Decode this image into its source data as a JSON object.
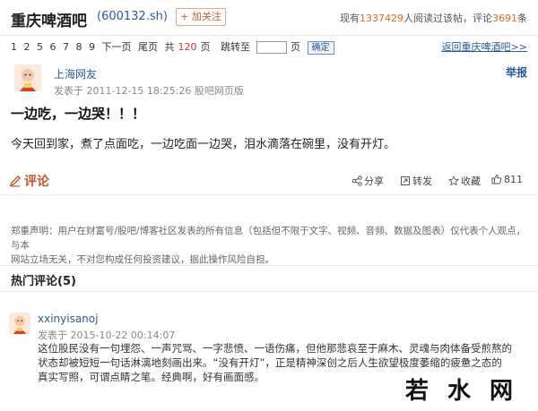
{
  "header": {
    "title": "重庆啤酒吧",
    "stock_code": "(600132.sh)",
    "follow_label": "+ 加关注",
    "stats_prefix": "现有",
    "readers": "1337429",
    "stats_mid": "人阅读过该帖，评论",
    "comments": "3691",
    "stats_suffix": "条"
  },
  "pager": {
    "pages": [
      "1",
      "2",
      "5",
      "6",
      "7",
      "8",
      "9"
    ],
    "next_label": "下一页",
    "last_label": "尾页",
    "total_prefix": "共",
    "total_pages": "120",
    "total_suffix": "页",
    "jump_label": "跳转至",
    "page_unit": "页",
    "confirm_label": "确定",
    "back_link": "返回重庆啤酒吧>>"
  },
  "post": {
    "author": "上海网友",
    "meta": "发表于 2011-12-15 18:25:26 股吧网页版",
    "report_label": "举报",
    "title": "一边吃，一边哭！！！",
    "body": "今天回到家，煮了点面吃，一边吃面一边哭，泪水滴落在碗里，没有开灯。"
  },
  "actions": {
    "comment_label": "评论",
    "share_label": "分享",
    "forward_label": "转发",
    "favorite_label": "收藏",
    "like_count": "811"
  },
  "disclaimer": {
    "line1": "郑重声明：用户在财富号/股吧/博客社区发表的所有信息（包括但不限于文字、视频、音频、数据及图表）仅代表个人观点，与本",
    "line2": "网站立场无关，不对您构成任何投资建议，据此操作风险自担。"
  },
  "hot_comments": {
    "title": "热门评论(5)",
    "items": [
      {
        "author": "xxinyisanoj",
        "meta": "发表于 2015-10-22 00:14:07",
        "line1": "这位股民没有一句埋怨、一声咒骂、一字悲愤、一语伤痛，但他那悲哀至于麻木、灵魂与肉体备受煎熬的",
        "line2": "状态却被短短一句话淋漓地刻画出来。“没有开灯”，正是精神深创之后人生欲望极度萎缩的疲惫之态的",
        "line3": "真实写照，可谓点睛之笔。经典啊，好有画面感。"
      }
    ]
  },
  "watermark": "若 水 网",
  "colors": {
    "link_blue": "#2b5a9a",
    "accent_orange": "#e06a1e",
    "comment_orange": "#c8562a"
  }
}
